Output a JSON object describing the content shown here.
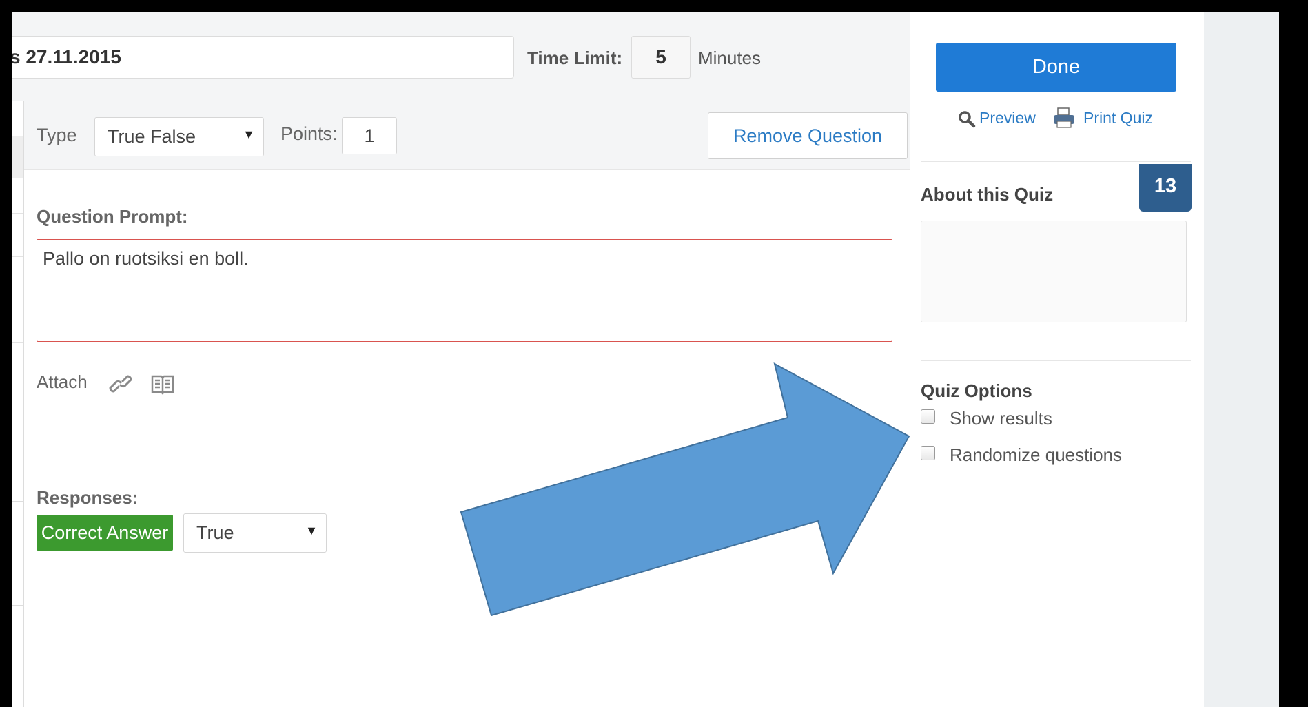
{
  "header": {
    "quiz_title_visible": "s 27.11.2015",
    "time_limit_label": "Time Limit:",
    "time_limit_value": "5",
    "time_limit_unit": "Minutes"
  },
  "question": {
    "type_label": "Type",
    "type_value": "True False",
    "points_label": "Points:",
    "points_value": "1",
    "remove_label": "Remove Question",
    "prompt_label": "Question Prompt:",
    "prompt_text": "Pallo on ruotsiksi en boll.",
    "attach_label": "Attach",
    "attach_icons": [
      "link-icon",
      "book-icon"
    ],
    "responses_label": "Responses:",
    "correct_answer_label": "Correct Answer",
    "answer_value": "True"
  },
  "sidebar": {
    "done_label": "Done",
    "preview_label": "Preview",
    "print_label": "Print Quiz",
    "about_title": "About this Quiz",
    "question_count": "13",
    "about_text": "",
    "options_title": "Quiz Options",
    "options": [
      {
        "label": "Show results",
        "checked": false
      },
      {
        "label": "Randomize questions",
        "checked": false
      }
    ]
  },
  "colors": {
    "done_button": "#1f7bd6",
    "link": "#2b7bc4",
    "correct_badge": "#3c9a2f",
    "count_badge": "#2e5e8e",
    "prompt_border": "#d9534f",
    "arrow_fill": "#5b9bd5",
    "arrow_stroke": "#41719c"
  }
}
